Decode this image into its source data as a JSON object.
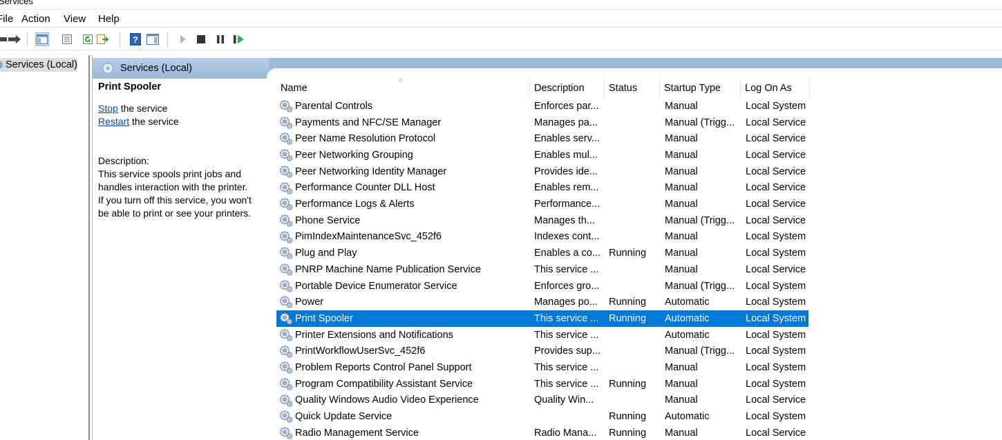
{
  "window": {
    "title": "Services"
  },
  "menu": [
    "File",
    "Action",
    "View",
    "Help"
  ],
  "toolbar": {
    "icons": [
      "back-arrow-icon",
      "forward-arrow-icon",
      "show-hide-console-tree-icon",
      "properties-icon",
      "refresh-icon",
      "export-list-icon",
      "help-icon",
      "show-hide-action-pane-icon",
      "start-service-icon",
      "stop-service-icon",
      "pause-service-icon",
      "resume-service-icon"
    ]
  },
  "tree": {
    "item": "Services (Local)"
  },
  "pane": {
    "header": "Services (Local)"
  },
  "details": {
    "title": "Print Spooler",
    "stop_link": "Stop",
    "stop_rest": " the service",
    "restart_link": "Restart",
    "restart_rest": " the service",
    "desc_label": "Description:",
    "desc_lines": [
      "This service spools print jobs and",
      "handles interaction with the printer.",
      "If you turn off this service, you won't",
      "be able to print or see your printers."
    ]
  },
  "columns": [
    "Name",
    "Description",
    "Status",
    "Startup Type",
    "Log On As"
  ],
  "rows": [
    {
      "name": "Parental Controls",
      "desc": "Enforces par...",
      "status": "",
      "startup": "Manual",
      "logon": "Local System"
    },
    {
      "name": "Payments and NFC/SE Manager",
      "desc": "Manages pa...",
      "status": "",
      "startup": "Manual (Trigg...",
      "logon": "Local Service"
    },
    {
      "name": "Peer Name Resolution Protocol",
      "desc": "Enables serv...",
      "status": "",
      "startup": "Manual",
      "logon": "Local Service"
    },
    {
      "name": "Peer Networking Grouping",
      "desc": "Enables mul...",
      "status": "",
      "startup": "Manual",
      "logon": "Local Service"
    },
    {
      "name": "Peer Networking Identity Manager",
      "desc": "Provides ide...",
      "status": "",
      "startup": "Manual",
      "logon": "Local Service"
    },
    {
      "name": "Performance Counter DLL Host",
      "desc": "Enables rem...",
      "status": "",
      "startup": "Manual",
      "logon": "Local Service"
    },
    {
      "name": "Performance Logs & Alerts",
      "desc": "Performance...",
      "status": "",
      "startup": "Manual",
      "logon": "Local Service"
    },
    {
      "name": "Phone Service",
      "desc": "Manages th...",
      "status": "",
      "startup": "Manual (Trigg...",
      "logon": "Local Service"
    },
    {
      "name": "PimIndexMaintenanceSvc_452f6",
      "desc": "Indexes cont...",
      "status": "",
      "startup": "Manual",
      "logon": "Local System"
    },
    {
      "name": "Plug and Play",
      "desc": "Enables a co...",
      "status": "Running",
      "startup": "Manual",
      "logon": "Local System"
    },
    {
      "name": "PNRP Machine Name Publication Service",
      "desc": "This service ...",
      "status": "",
      "startup": "Manual",
      "logon": "Local Service"
    },
    {
      "name": "Portable Device Enumerator Service",
      "desc": "Enforces gro...",
      "status": "",
      "startup": "Manual (Trigg...",
      "logon": "Local System"
    },
    {
      "name": "Power",
      "desc": "Manages po...",
      "status": "Running",
      "startup": "Automatic",
      "logon": "Local System"
    },
    {
      "name": "Print Spooler",
      "desc": "This service ...",
      "status": "Running",
      "startup": "Automatic",
      "logon": "Local System",
      "selected": true
    },
    {
      "name": "Printer Extensions and Notifications",
      "desc": "This service ...",
      "status": "",
      "startup": "Automatic",
      "logon": "Local System"
    },
    {
      "name": "PrintWorkflowUserSvc_452f6",
      "desc": "Provides sup...",
      "status": "",
      "startup": "Manual (Trigg...",
      "logon": "Local System"
    },
    {
      "name": "Problem Reports Control Panel Support",
      "desc": "This service ...",
      "status": "",
      "startup": "Manual",
      "logon": "Local System"
    },
    {
      "name": "Program Compatibility Assistant Service",
      "desc": "This service ...",
      "status": "Running",
      "startup": "Manual",
      "logon": "Local System"
    },
    {
      "name": "Quality Windows Audio Video Experience",
      "desc": "Quality Win...",
      "status": "",
      "startup": "Manual",
      "logon": "Local Service"
    },
    {
      "name": "Quick Update Service",
      "desc": "",
      "status": "Running",
      "startup": "Automatic",
      "logon": "Local System"
    },
    {
      "name": "Radio Management Service",
      "desc": "Radio Mana...",
      "status": "Running",
      "startup": "Manual",
      "logon": "Local Service"
    }
  ],
  "colors": {
    "selection": "#0078d7",
    "header_bar": "#9db9d9",
    "link": "#0645ad"
  }
}
